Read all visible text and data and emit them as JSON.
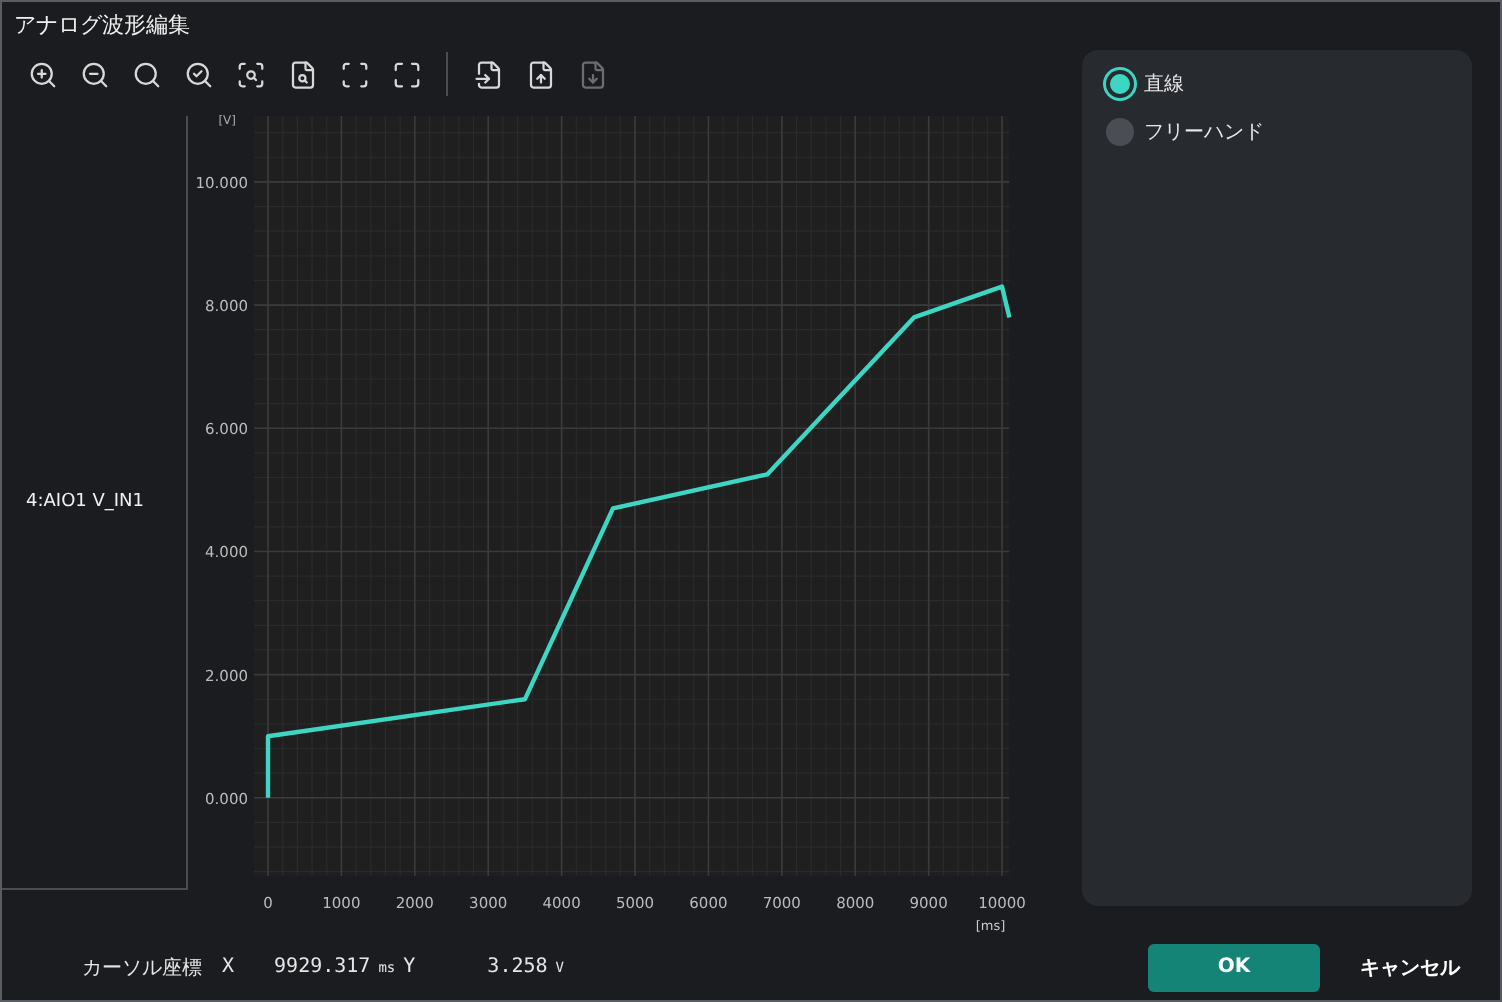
{
  "window": {
    "title": "アナログ波形編集"
  },
  "toolbar": [
    {
      "kind": "icon",
      "disabled": false
    },
    {
      "kind": "icon",
      "disabled": false
    },
    {
      "kind": "icon",
      "disabled": false
    },
    {
      "kind": "icon",
      "disabled": false
    },
    {
      "kind": "icon",
      "disabled": false
    },
    {
      "kind": "icon",
      "disabled": false
    },
    {
      "kind": "icon",
      "disabled": false
    },
    {
      "kind": "icon",
      "disabled": false
    },
    {
      "kind": "separator"
    },
    {
      "kind": "icon",
      "disabled": false
    },
    {
      "kind": "icon",
      "disabled": false
    },
    {
      "kind": "icon",
      "disabled": true
    }
  ],
  "channel": {
    "label": "4:AIO1 V_IN1"
  },
  "chart": {
    "chart_data": {
      "type": "line",
      "xlabel": "[ms]",
      "ylabel": "[V]",
      "x": [
        0,
        0,
        3500,
        4700,
        6800,
        8800,
        10000,
        10100
      ],
      "series": [
        {
          "color": "#3dd6c3",
          "values": [
            0,
            1.0,
            1.6,
            4.7,
            5.25,
            7.8,
            8.3,
            7.8
          ]
        }
      ],
      "grid": true,
      "xlim": [
        0,
        10100
      ],
      "ylim": [
        -1.27,
        11.07
      ],
      "xticks": [
        0,
        1000,
        2000,
        3000,
        4000,
        5000,
        6000,
        7000,
        8000,
        9000,
        10000
      ],
      "yticks": [
        {
          "value": 0,
          "label": "0.000"
        },
        {
          "value": 2,
          "label": "2.000"
        },
        {
          "value": 4,
          "label": "4.000"
        },
        {
          "value": 6,
          "label": "6.000"
        },
        {
          "value": 8,
          "label": "8.000"
        },
        {
          "value": 10,
          "label": "10.000"
        }
      ]
    }
  },
  "modes": [
    {
      "label": "直線",
      "selected": true
    },
    {
      "label": "フリーハンド",
      "selected": false
    }
  ],
  "cursor": {
    "label": "カーソル座標",
    "x_label": "X",
    "x_value": "9929.317",
    "x_unit": "ms",
    "y_label": "Y",
    "y_value": "3.258",
    "y_unit": "V"
  },
  "buttons": [
    {
      "kind": "primary",
      "label": "OK"
    },
    {
      "kind": "text",
      "label": "キャンセル"
    }
  ]
}
